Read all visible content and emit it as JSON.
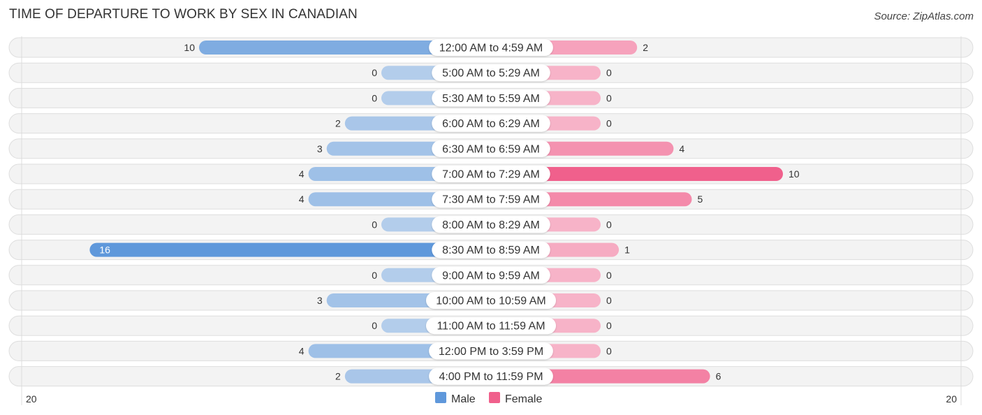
{
  "chart_data": {
    "type": "bar",
    "orientation": "horizontal-diverging",
    "title": "TIME OF DEPARTURE TO WORK BY SEX IN CANADIAN",
    "source": "Source: ZipAtlas.com",
    "categories": [
      "12:00 AM to 4:59 AM",
      "5:00 AM to 5:29 AM",
      "5:30 AM to 5:59 AM",
      "6:00 AM to 6:29 AM",
      "6:30 AM to 6:59 AM",
      "7:00 AM to 7:29 AM",
      "7:30 AM to 7:59 AM",
      "8:00 AM to 8:29 AM",
      "8:30 AM to 8:59 AM",
      "9:00 AM to 9:59 AM",
      "10:00 AM to 10:59 AM",
      "11:00 AM to 11:59 AM",
      "12:00 PM to 3:59 PM",
      "4:00 PM to 11:59 PM"
    ],
    "series": [
      {
        "name": "Male",
        "color": "#6a9fdc",
        "values": [
          10,
          0,
          0,
          2,
          3,
          4,
          4,
          0,
          16,
          0,
          3,
          0,
          4,
          2
        ]
      },
      {
        "name": "Female",
        "color": "#f06890",
        "values": [
          2,
          0,
          0,
          0,
          4,
          10,
          5,
          0,
          1,
          0,
          0,
          0,
          0,
          6
        ]
      }
    ],
    "axis": {
      "left_label": "20",
      "right_label": "20",
      "max": 20
    },
    "legend": {
      "position": "bottom-center",
      "items": [
        "Male",
        "Female"
      ]
    }
  },
  "header": {
    "title": "TIME OF DEPARTURE TO WORK BY SEX IN CANADIAN",
    "source": "Source: ZipAtlas.com"
  }
}
